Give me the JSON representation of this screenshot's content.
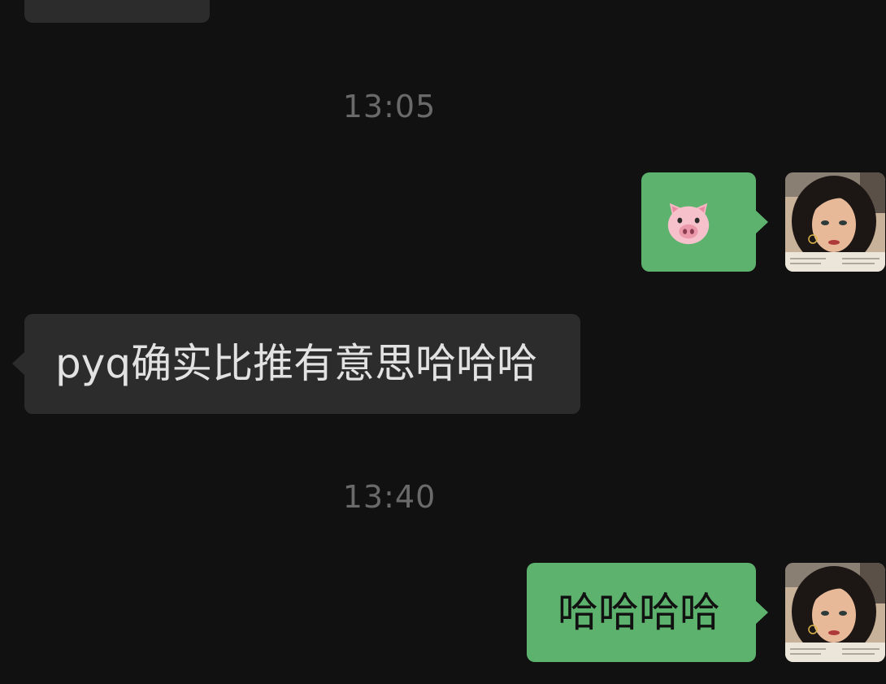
{
  "conversation": {
    "messages": [
      {
        "type": "incoming",
        "text": ""
      },
      {
        "type": "timestamp",
        "text": "13:05"
      },
      {
        "type": "outgoing",
        "emoji": "pig-face-emoji"
      },
      {
        "type": "incoming",
        "text": "pyq确实比推有意思哈哈哈"
      },
      {
        "type": "timestamp",
        "text": "13:40"
      },
      {
        "type": "outgoing",
        "text": "哈哈哈哈"
      }
    ]
  },
  "colors": {
    "background": "#111111",
    "incoming_bubble": "#2c2c2c",
    "outgoing_bubble": "#5db36e",
    "timestamp_text": "#6a6a6a",
    "incoming_text": "#e2e2e2",
    "outgoing_text": "#111111"
  },
  "icons": {
    "sender_avatar": "user-avatar",
    "sticker": "pig-face-emoji"
  }
}
